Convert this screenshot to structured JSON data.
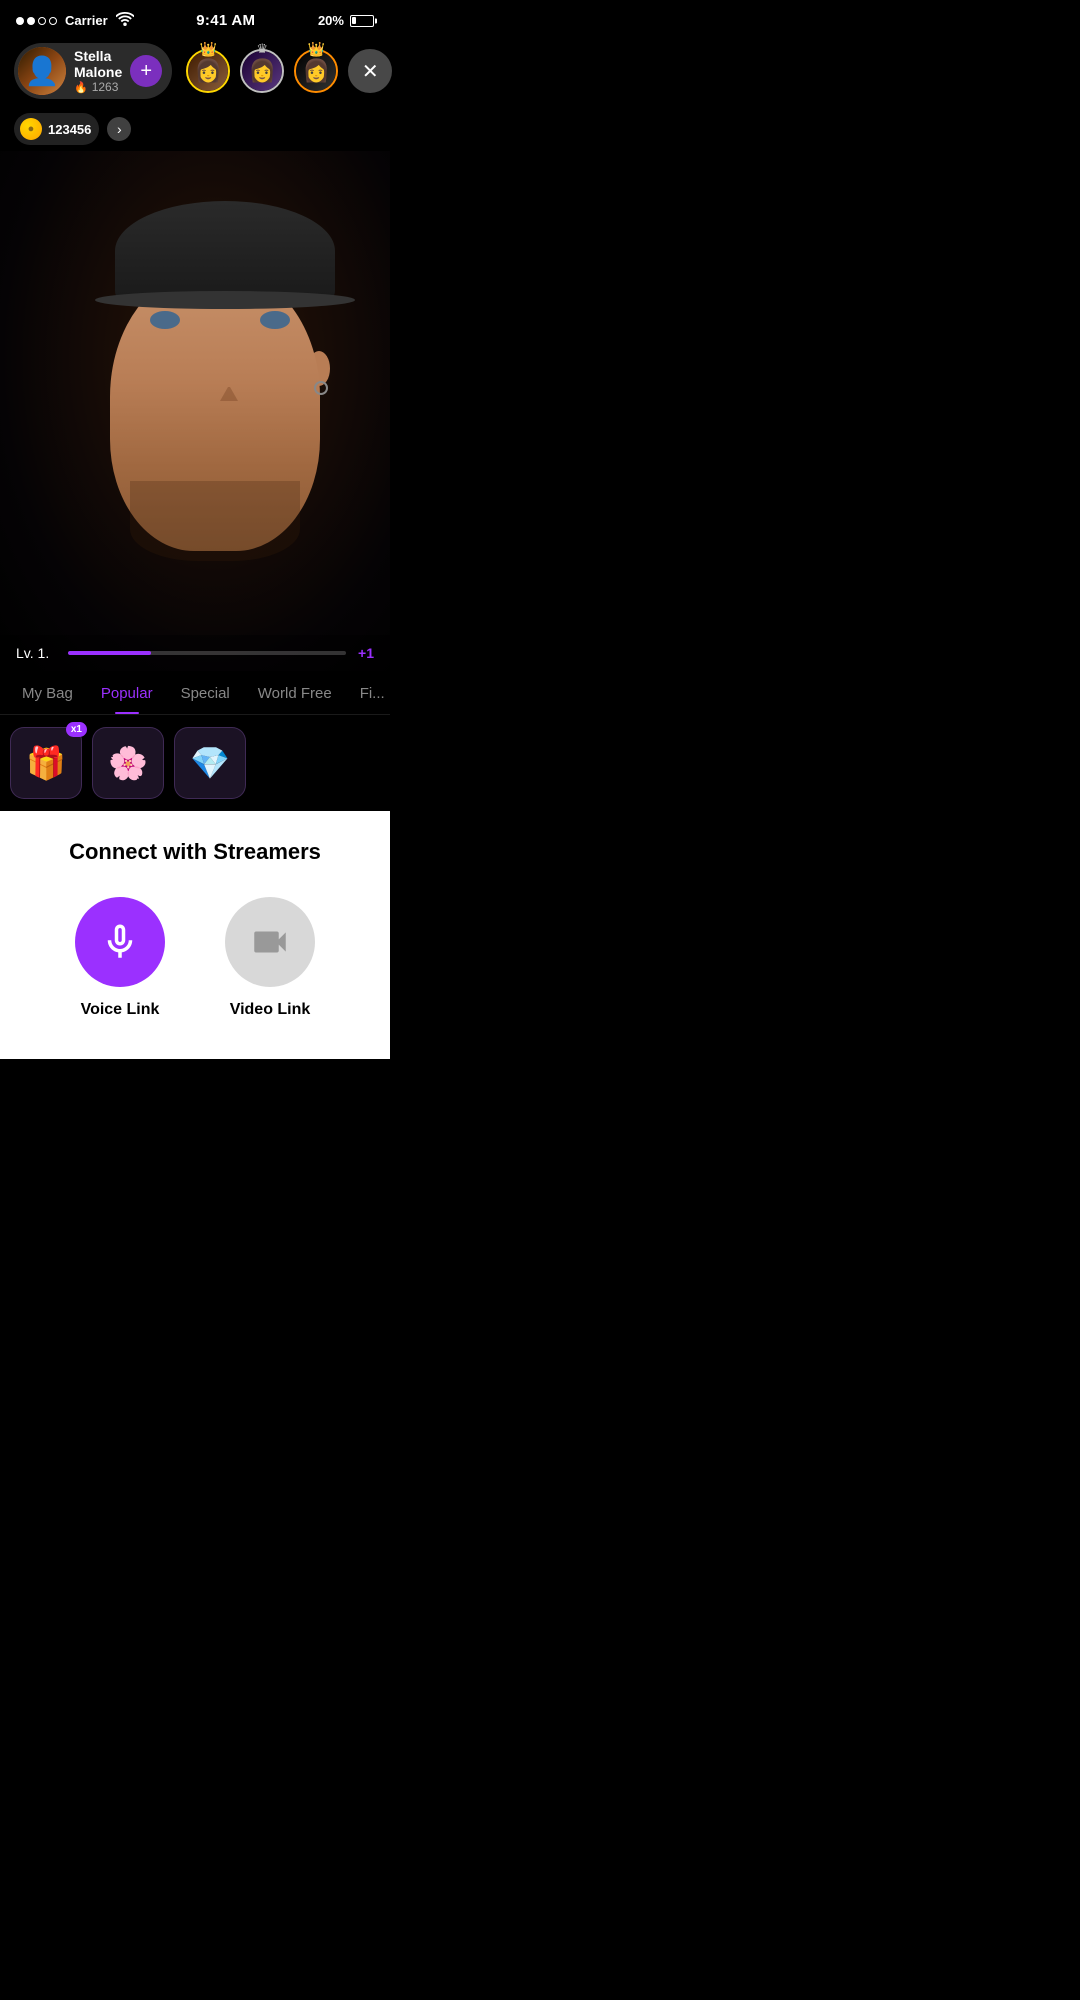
{
  "statusBar": {
    "carrier": "Carrier",
    "time": "9:41 AM",
    "battery": "20%"
  },
  "streamer": {
    "name": "Stella Malone",
    "score": "1263",
    "plusLabel": "+",
    "coinAmount": "123456"
  },
  "topAvatars": [
    {
      "rank": 1,
      "crownColor": "gold",
      "emoji": "👩"
    },
    {
      "rank": 2,
      "crownColor": "silver",
      "emoji": "👩"
    },
    {
      "rank": 3,
      "crownColor": "orange",
      "emoji": "👩"
    }
  ],
  "levelBar": {
    "label": "Lv. 1.",
    "plus": "+1"
  },
  "giftTabs": [
    {
      "label": "My Bag",
      "active": false
    },
    {
      "label": "Popular",
      "active": true
    },
    {
      "label": "Special",
      "active": false
    },
    {
      "label": "World Free",
      "active": false
    },
    {
      "label": "Fi...",
      "active": false
    }
  ],
  "giftItems": [
    {
      "emoji": "🎁",
      "badge": "x1"
    },
    {
      "emoji": "🌸",
      "badge": null
    },
    {
      "emoji": "💎",
      "badge": null
    }
  ],
  "connectSection": {
    "title": "Connect with Streamers",
    "voiceLabel": "Voice Link",
    "videoLabel": "Video Link"
  }
}
